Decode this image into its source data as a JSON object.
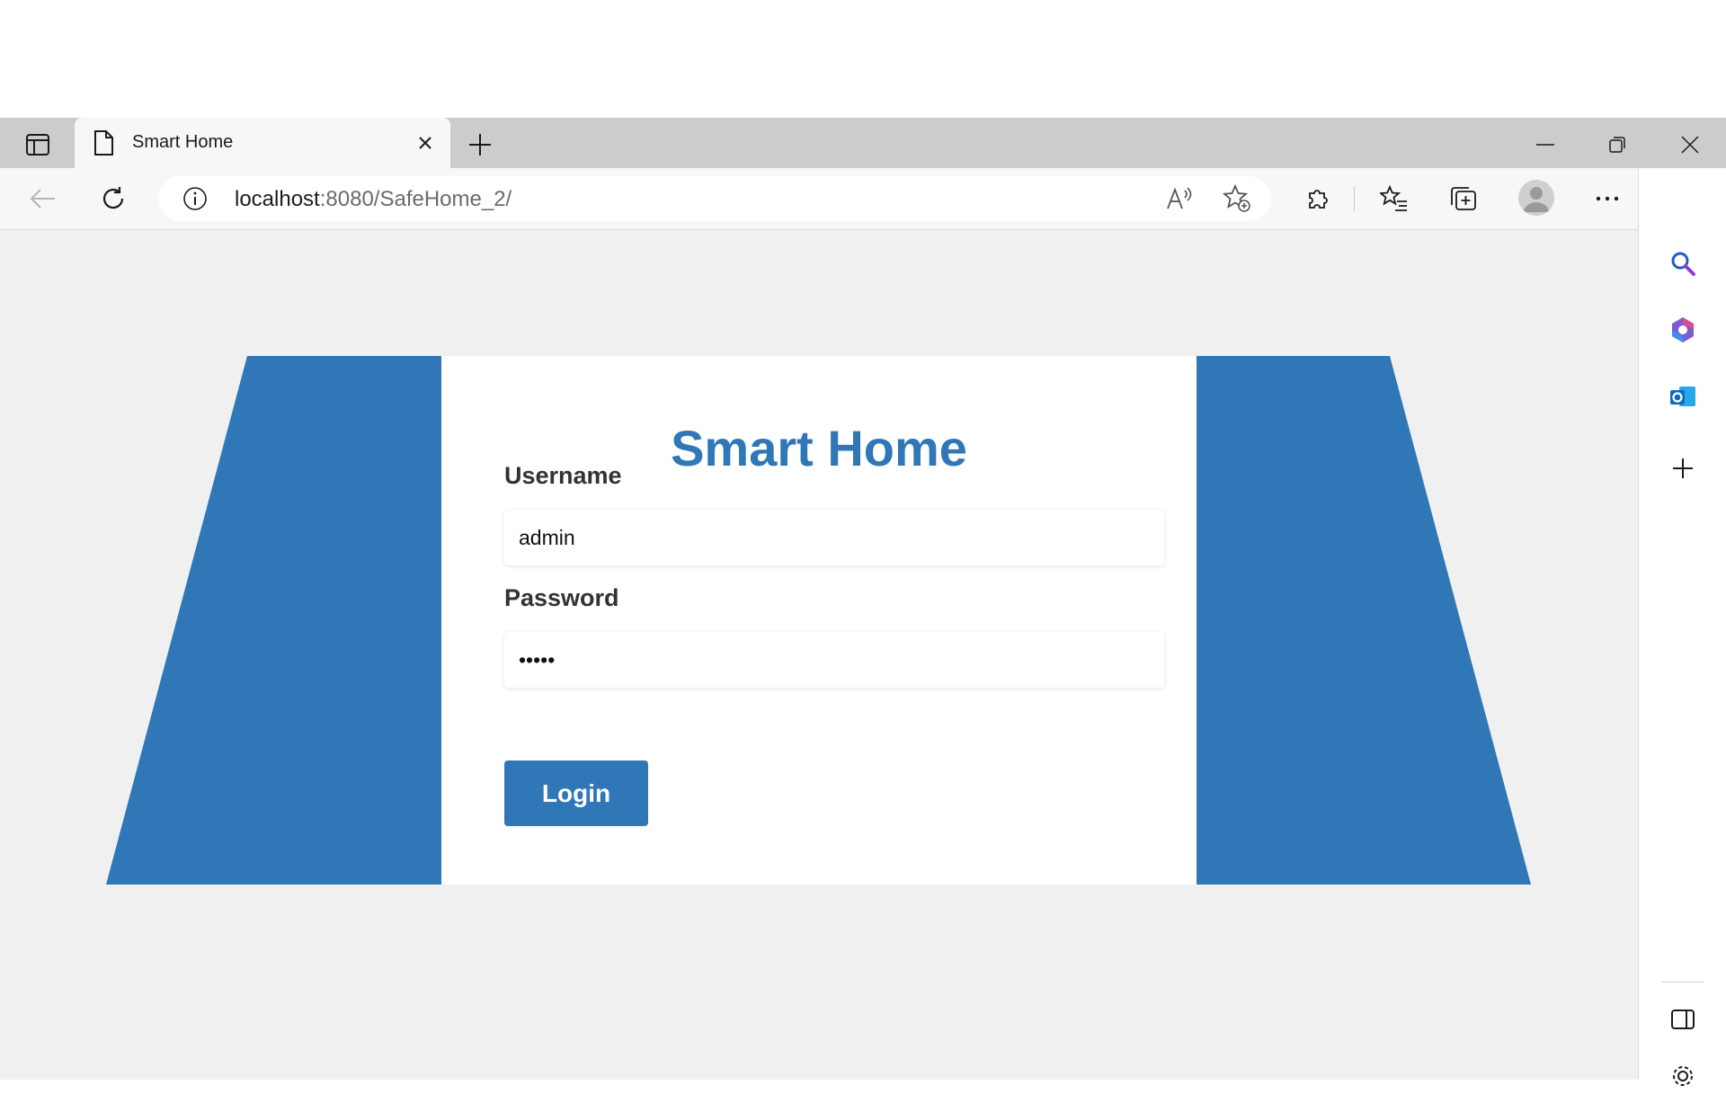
{
  "browser": {
    "tab": {
      "title": "Smart Home"
    },
    "address": {
      "host": "localhost",
      "rest": ":8080/SafeHome_2/"
    }
  },
  "page": {
    "title": "Smart Home",
    "username": {
      "label": "Username",
      "value": "admin"
    },
    "password": {
      "label": "Password",
      "value": "•••••"
    },
    "login_label": "Login"
  },
  "colors": {
    "accent": "#2f77b7",
    "page_bg": "#f0f0f0"
  }
}
